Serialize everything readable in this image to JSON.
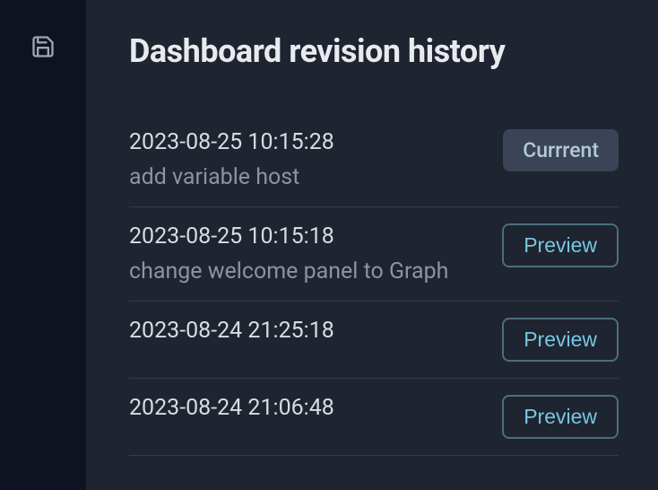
{
  "sidebar": {
    "save_icon": "save-icon"
  },
  "header": {
    "title": "Dashboard revision history"
  },
  "revisions": [
    {
      "timestamp": "2023-08-25 10:15:28",
      "description": "add variable host",
      "action_label": "Currrent",
      "is_current": true
    },
    {
      "timestamp": "2023-08-25 10:15:18",
      "description": "change welcome panel to Graph",
      "action_label": "Preview",
      "is_current": false
    },
    {
      "timestamp": "2023-08-24 21:25:18",
      "description": "",
      "action_label": "Preview",
      "is_current": false
    },
    {
      "timestamp": "2023-08-24 21:06:48",
      "description": "",
      "action_label": "Preview",
      "is_current": false
    }
  ]
}
